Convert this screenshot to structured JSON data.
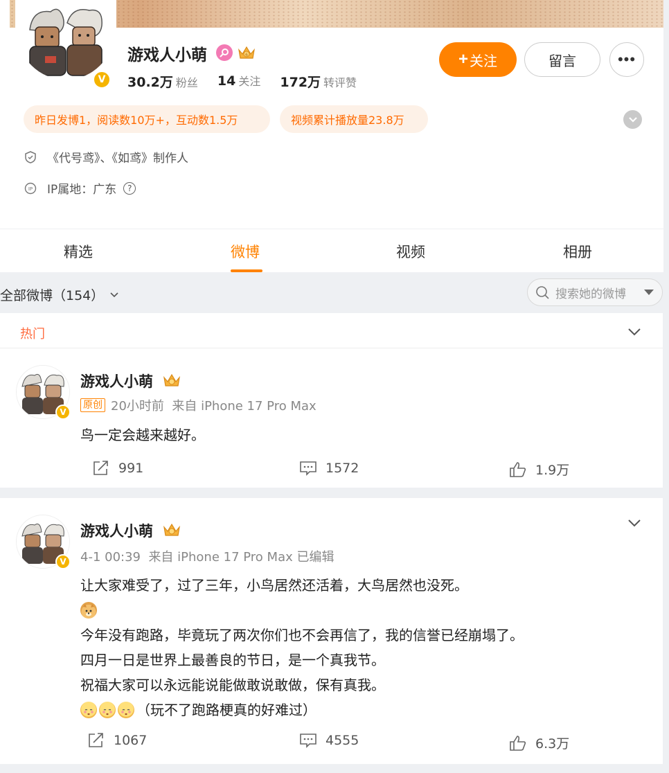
{
  "profile": {
    "name": "游戏人小萌",
    "verified_badge": "V",
    "stats": [
      {
        "value": "30.2万",
        "label": "粉丝"
      },
      {
        "value": "14",
        "label": "关注"
      },
      {
        "value": "172万",
        "label": "转评赞"
      }
    ],
    "follow_label": "关注",
    "follow_plus": "+",
    "message_label": "留言",
    "more_label": "•••",
    "pills": [
      "昨日发博1，阅读数10万+，互动数1.5万",
      "视频累计播放量23.8万"
    ],
    "bio": "《代号鸢》、《如鸢》制作人",
    "ip_location": "IP属地：广东",
    "ip_icon": "IP",
    "help_mark": "?"
  },
  "tabs": [
    "精选",
    "微博",
    "视频",
    "相册"
  ],
  "active_tab": "微博",
  "filter": {
    "label": "全部微博（154）"
  },
  "search": {
    "placeholder": "搜索她的微博"
  },
  "hot_section": {
    "label": "热门"
  },
  "posts": [
    {
      "author": "游戏人小萌",
      "original_tag": "原创",
      "meta": "20小时前  来自 iPhone 17 Pro Max",
      "text": [
        "鸟一定会越来越好。"
      ],
      "reposts": "991",
      "comments": "1572",
      "likes": "1.9万"
    },
    {
      "author": "游戏人小萌",
      "meta": "4-1 00:39  来自 iPhone 17 Pro Max 已编辑",
      "text": [
        "让大家难受了，过了三年，小鸟居然还活着，大鸟居然也没死。",
        "",
        "今年没有跑路，毕竟玩了两次你们也不会再信了，我的信誉已经崩塌了。",
        "四月一日是世界上最善良的节日，是一个真我节。",
        "祝福大家可以永远能说能做敢说敢做，保有真我。",
        "（玩不了跑路梗真的好难过）"
      ],
      "reposts": "1067",
      "comments": "4555",
      "likes": "6.3万"
    }
  ],
  "colors": {
    "accent": "#ff8200",
    "hot": "#ff6a3d",
    "pill_bg": "#fdf1e7"
  }
}
